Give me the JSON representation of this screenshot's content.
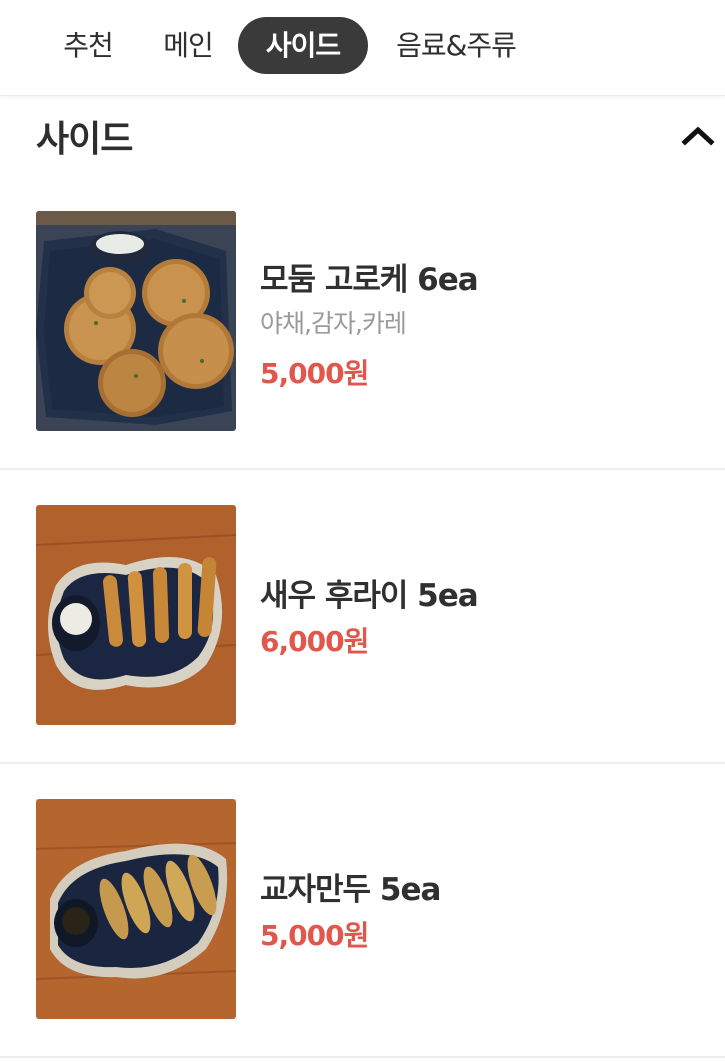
{
  "tabs": [
    {
      "label": "추천",
      "active": false
    },
    {
      "label": "메인",
      "active": false
    },
    {
      "label": "사이드",
      "active": true
    },
    {
      "label": "음료&주류",
      "active": false
    }
  ],
  "section": {
    "title": "사이드",
    "toggle_icon": "chevron-up-icon"
  },
  "menu": [
    {
      "name": "모둠 고로케 6ea",
      "description": "야채,감자,카레",
      "price": "5,000원",
      "photo": "croquette"
    },
    {
      "name": "새우 후라이 5ea",
      "description": "",
      "price": "6,000원",
      "photo": "fried-shrimp"
    },
    {
      "name": "교자만두 5ea",
      "description": "",
      "price": "5,000원",
      "photo": "gyoza"
    }
  ],
  "colors": {
    "price": "#e2574c",
    "active_tab_bg": "#3a3a3a",
    "text": "#333333"
  }
}
